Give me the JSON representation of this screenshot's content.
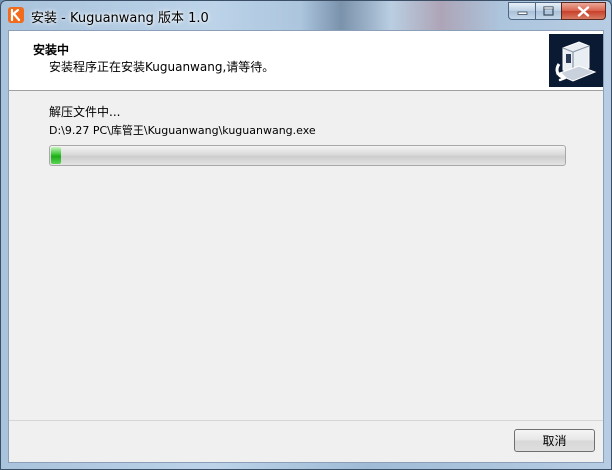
{
  "window": {
    "title": "安装 - Kuguanwang 版本 1.0",
    "app_icon_label": "K"
  },
  "header": {
    "title": "安装中",
    "subtitle": "安装程序正在安装Kuguanwang,请等待。",
    "logo_icon": "installer-computer-icon"
  },
  "status": {
    "text": "解压文件中...",
    "file_path": "D:\\9.27 PC\\库管王\\Kuguanwang\\kuguanwang.exe"
  },
  "progress": {
    "fraction": 0.02,
    "color": "#33c42e"
  },
  "buttons": {
    "cancel_label": "取消"
  },
  "caption": {
    "minimize_icon": "minimize-icon",
    "maximize_icon": "maximize-icon",
    "close_icon": "close-icon"
  }
}
